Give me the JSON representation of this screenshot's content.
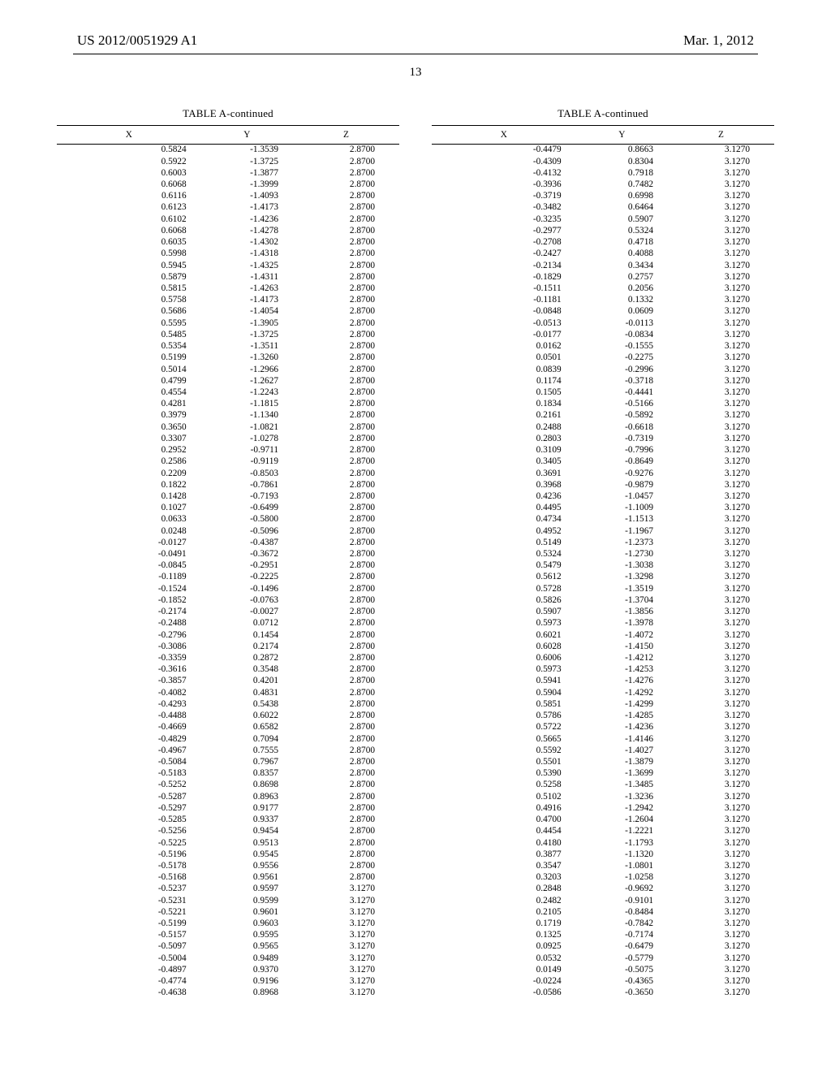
{
  "header": {
    "left": "US 2012/0051929 A1",
    "right": "Mar. 1, 2012"
  },
  "page_number": "13",
  "table_title": "TABLE A-continued",
  "column_headers": [
    "X",
    "Y",
    "Z"
  ],
  "left_rows": [
    [
      "0.5824",
      "-1.3539",
      "2.8700"
    ],
    [
      "0.5922",
      "-1.3725",
      "2.8700"
    ],
    [
      "0.6003",
      "-1.3877",
      "2.8700"
    ],
    [
      "0.6068",
      "-1.3999",
      "2.8700"
    ],
    [
      "0.6116",
      "-1.4093",
      "2.8700"
    ],
    [
      "0.6123",
      "-1.4173",
      "2.8700"
    ],
    [
      "0.6102",
      "-1.4236",
      "2.8700"
    ],
    [
      "0.6068",
      "-1.4278",
      "2.8700"
    ],
    [
      "0.6035",
      "-1.4302",
      "2.8700"
    ],
    [
      "0.5998",
      "-1.4318",
      "2.8700"
    ],
    [
      "0.5945",
      "-1.4325",
      "2.8700"
    ],
    [
      "0.5879",
      "-1.4311",
      "2.8700"
    ],
    [
      "0.5815",
      "-1.4263",
      "2.8700"
    ],
    [
      "0.5758",
      "-1.4173",
      "2.8700"
    ],
    [
      "0.5686",
      "-1.4054",
      "2.8700"
    ],
    [
      "0.5595",
      "-1.3905",
      "2.8700"
    ],
    [
      "0.5485",
      "-1.3725",
      "2.8700"
    ],
    [
      "0.5354",
      "-1.3511",
      "2.8700"
    ],
    [
      "0.5199",
      "-1.3260",
      "2.8700"
    ],
    [
      "0.5014",
      "-1.2966",
      "2.8700"
    ],
    [
      "0.4799",
      "-1.2627",
      "2.8700"
    ],
    [
      "0.4554",
      "-1.2243",
      "2.8700"
    ],
    [
      "0.4281",
      "-1.1815",
      "2.8700"
    ],
    [
      "0.3979",
      "-1.1340",
      "2.8700"
    ],
    [
      "0.3650",
      "-1.0821",
      "2.8700"
    ],
    [
      "0.3307",
      "-1.0278",
      "2.8700"
    ],
    [
      "0.2952",
      "-0.9711",
      "2.8700"
    ],
    [
      "0.2586",
      "-0.9119",
      "2.8700"
    ],
    [
      "0.2209",
      "-0.8503",
      "2.8700"
    ],
    [
      "0.1822",
      "-0.7861",
      "2.8700"
    ],
    [
      "0.1428",
      "-0.7193",
      "2.8700"
    ],
    [
      "0.1027",
      "-0.6499",
      "2.8700"
    ],
    [
      "0.0633",
      "-0.5800",
      "2.8700"
    ],
    [
      "0.0248",
      "-0.5096",
      "2.8700"
    ],
    [
      "-0.0127",
      "-0.4387",
      "2.8700"
    ],
    [
      "-0.0491",
      "-0.3672",
      "2.8700"
    ],
    [
      "-0.0845",
      "-0.2951",
      "2.8700"
    ],
    [
      "-0.1189",
      "-0.2225",
      "2.8700"
    ],
    [
      "-0.1524",
      "-0.1496",
      "2.8700"
    ],
    [
      "-0.1852",
      "-0.0763",
      "2.8700"
    ],
    [
      "-0.2174",
      "-0.0027",
      "2.8700"
    ],
    [
      "-0.2488",
      "0.0712",
      "2.8700"
    ],
    [
      "-0.2796",
      "0.1454",
      "2.8700"
    ],
    [
      "-0.3086",
      "0.2174",
      "2.8700"
    ],
    [
      "-0.3359",
      "0.2872",
      "2.8700"
    ],
    [
      "-0.3616",
      "0.3548",
      "2.8700"
    ],
    [
      "-0.3857",
      "0.4201",
      "2.8700"
    ],
    [
      "-0.4082",
      "0.4831",
      "2.8700"
    ],
    [
      "-0.4293",
      "0.5438",
      "2.8700"
    ],
    [
      "-0.4488",
      "0.6022",
      "2.8700"
    ],
    [
      "-0.4669",
      "0.6582",
      "2.8700"
    ],
    [
      "-0.4829",
      "0.7094",
      "2.8700"
    ],
    [
      "-0.4967",
      "0.7555",
      "2.8700"
    ],
    [
      "-0.5084",
      "0.7967",
      "2.8700"
    ],
    [
      "-0.5183",
      "0.8357",
      "2.8700"
    ],
    [
      "-0.5252",
      "0.8698",
      "2.8700"
    ],
    [
      "-0.5287",
      "0.8963",
      "2.8700"
    ],
    [
      "-0.5297",
      "0.9177",
      "2.8700"
    ],
    [
      "-0.5285",
      "0.9337",
      "2.8700"
    ],
    [
      "-0.5256",
      "0.9454",
      "2.8700"
    ],
    [
      "-0.5225",
      "0.9513",
      "2.8700"
    ],
    [
      "-0.5196",
      "0.9545",
      "2.8700"
    ],
    [
      "-0.5178",
      "0.9556",
      "2.8700"
    ],
    [
      "-0.5168",
      "0.9561",
      "2.8700"
    ],
    [
      "-0.5237",
      "0.9597",
      "3.1270"
    ],
    [
      "-0.5231",
      "0.9599",
      "3.1270"
    ],
    [
      "-0.5221",
      "0.9601",
      "3.1270"
    ],
    [
      "-0.5199",
      "0.9603",
      "3.1270"
    ],
    [
      "-0.5157",
      "0.9595",
      "3.1270"
    ],
    [
      "-0.5097",
      "0.9565",
      "3.1270"
    ],
    [
      "-0.5004",
      "0.9489",
      "3.1270"
    ],
    [
      "-0.4897",
      "0.9370",
      "3.1270"
    ],
    [
      "-0.4774",
      "0.9196",
      "3.1270"
    ],
    [
      "-0.4638",
      "0.8968",
      "3.1270"
    ]
  ],
  "right_rows": [
    [
      "-0.4479",
      "0.8663",
      "3.1270"
    ],
    [
      "-0.4309",
      "0.8304",
      "3.1270"
    ],
    [
      "-0.4132",
      "0.7918",
      "3.1270"
    ],
    [
      "-0.3936",
      "0.7482",
      "3.1270"
    ],
    [
      "-0.3719",
      "0.6998",
      "3.1270"
    ],
    [
      "-0.3482",
      "0.6464",
      "3.1270"
    ],
    [
      "-0.3235",
      "0.5907",
      "3.1270"
    ],
    [
      "-0.2977",
      "0.5324",
      "3.1270"
    ],
    [
      "-0.2708",
      "0.4718",
      "3.1270"
    ],
    [
      "-0.2427",
      "0.4088",
      "3.1270"
    ],
    [
      "-0.2134",
      "0.3434",
      "3.1270"
    ],
    [
      "-0.1829",
      "0.2757",
      "3.1270"
    ],
    [
      "-0.1511",
      "0.2056",
      "3.1270"
    ],
    [
      "-0.1181",
      "0.1332",
      "3.1270"
    ],
    [
      "-0.0848",
      "0.0609",
      "3.1270"
    ],
    [
      "-0.0513",
      "-0.0113",
      "3.1270"
    ],
    [
      "-0.0177",
      "-0.0834",
      "3.1270"
    ],
    [
      "0.0162",
      "-0.1555",
      "3.1270"
    ],
    [
      "0.0501",
      "-0.2275",
      "3.1270"
    ],
    [
      "0.0839",
      "-0.2996",
      "3.1270"
    ],
    [
      "0.1174",
      "-0.3718",
      "3.1270"
    ],
    [
      "0.1505",
      "-0.4441",
      "3.1270"
    ],
    [
      "0.1834",
      "-0.5166",
      "3.1270"
    ],
    [
      "0.2161",
      "-0.5892",
      "3.1270"
    ],
    [
      "0.2488",
      "-0.6618",
      "3.1270"
    ],
    [
      "0.2803",
      "-0.7319",
      "3.1270"
    ],
    [
      "0.3109",
      "-0.7996",
      "3.1270"
    ],
    [
      "0.3405",
      "-0.8649",
      "3.1270"
    ],
    [
      "0.3691",
      "-0.9276",
      "3.1270"
    ],
    [
      "0.3968",
      "-0.9879",
      "3.1270"
    ],
    [
      "0.4236",
      "-1.0457",
      "3.1270"
    ],
    [
      "0.4495",
      "-1.1009",
      "3.1270"
    ],
    [
      "0.4734",
      "-1.1513",
      "3.1270"
    ],
    [
      "0.4952",
      "-1.1967",
      "3.1270"
    ],
    [
      "0.5149",
      "-1.2373",
      "3.1270"
    ],
    [
      "0.5324",
      "-1.2730",
      "3.1270"
    ],
    [
      "0.5479",
      "-1.3038",
      "3.1270"
    ],
    [
      "0.5612",
      "-1.3298",
      "3.1270"
    ],
    [
      "0.5728",
      "-1.3519",
      "3.1270"
    ],
    [
      "0.5826",
      "-1.3704",
      "3.1270"
    ],
    [
      "0.5907",
      "-1.3856",
      "3.1270"
    ],
    [
      "0.5973",
      "-1.3978",
      "3.1270"
    ],
    [
      "0.6021",
      "-1.4072",
      "3.1270"
    ],
    [
      "0.6028",
      "-1.4150",
      "3.1270"
    ],
    [
      "0.6006",
      "-1.4212",
      "3.1270"
    ],
    [
      "0.5973",
      "-1.4253",
      "3.1270"
    ],
    [
      "0.5941",
      "-1.4276",
      "3.1270"
    ],
    [
      "0.5904",
      "-1.4292",
      "3.1270"
    ],
    [
      "0.5851",
      "-1.4299",
      "3.1270"
    ],
    [
      "0.5786",
      "-1.4285",
      "3.1270"
    ],
    [
      "0.5722",
      "-1.4236",
      "3.1270"
    ],
    [
      "0.5665",
      "-1.4146",
      "3.1270"
    ],
    [
      "0.5592",
      "-1.4027",
      "3.1270"
    ],
    [
      "0.5501",
      "-1.3879",
      "3.1270"
    ],
    [
      "0.5390",
      "-1.3699",
      "3.1270"
    ],
    [
      "0.5258",
      "-1.3485",
      "3.1270"
    ],
    [
      "0.5102",
      "-1.3236",
      "3.1270"
    ],
    [
      "0.4916",
      "-1.2942",
      "3.1270"
    ],
    [
      "0.4700",
      "-1.2604",
      "3.1270"
    ],
    [
      "0.4454",
      "-1.2221",
      "3.1270"
    ],
    [
      "0.4180",
      "-1.1793",
      "3.1270"
    ],
    [
      "0.3877",
      "-1.1320",
      "3.1270"
    ],
    [
      "0.3547",
      "-1.0801",
      "3.1270"
    ],
    [
      "0.3203",
      "-1.0258",
      "3.1270"
    ],
    [
      "0.2848",
      "-0.9692",
      "3.1270"
    ],
    [
      "0.2482",
      "-0.9101",
      "3.1270"
    ],
    [
      "0.2105",
      "-0.8484",
      "3.1270"
    ],
    [
      "0.1719",
      "-0.7842",
      "3.1270"
    ],
    [
      "0.1325",
      "-0.7174",
      "3.1270"
    ],
    [
      "0.0925",
      "-0.6479",
      "3.1270"
    ],
    [
      "0.0532",
      "-0.5779",
      "3.1270"
    ],
    [
      "0.0149",
      "-0.5075",
      "3.1270"
    ],
    [
      "-0.0224",
      "-0.4365",
      "3.1270"
    ],
    [
      "-0.0586",
      "-0.3650",
      "3.1270"
    ]
  ]
}
